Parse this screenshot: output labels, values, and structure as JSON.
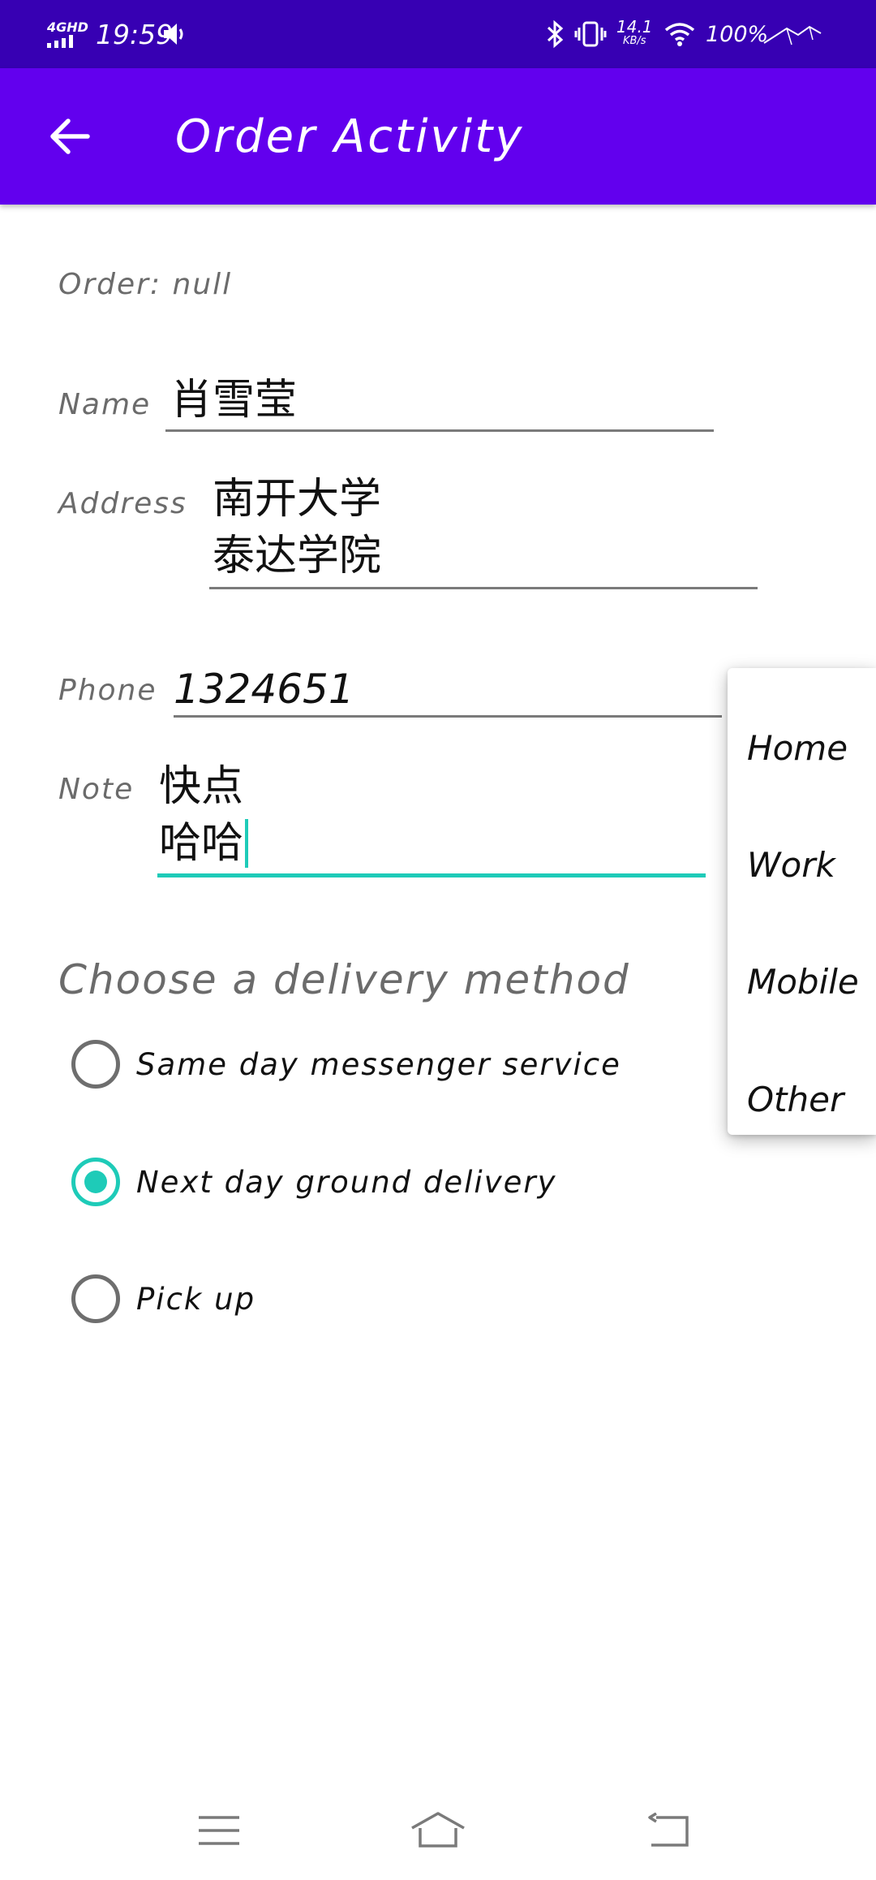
{
  "status_bar": {
    "network": "4GHD",
    "time": "19:59",
    "speed_value": "14.1",
    "speed_unit": "KB/s",
    "battery": "100%"
  },
  "app_bar": {
    "title": "Order Activity"
  },
  "form": {
    "order_label": "Order: null",
    "name_label": "Name",
    "name_value": "肖雪莹",
    "address_label": "Address",
    "address_line1": "南开大学",
    "address_line2": "泰达学院",
    "phone_label": "Phone",
    "phone_value": "1324651",
    "note_label": "Note",
    "note_line1": "快点",
    "note_line2": "哈哈"
  },
  "delivery": {
    "title": "Choose a delivery method",
    "options": [
      {
        "label": "Same day messenger service",
        "checked": false
      },
      {
        "label": "Next day ground delivery",
        "checked": true
      },
      {
        "label": "Pick up",
        "checked": false
      }
    ]
  },
  "phone_type_menu": {
    "items": [
      "Home",
      "Work",
      "Mobile",
      "Other"
    ]
  },
  "colors": {
    "status_bar": "#3700b3",
    "app_bar": "#6200ee",
    "accent": "#1ecbb8"
  }
}
